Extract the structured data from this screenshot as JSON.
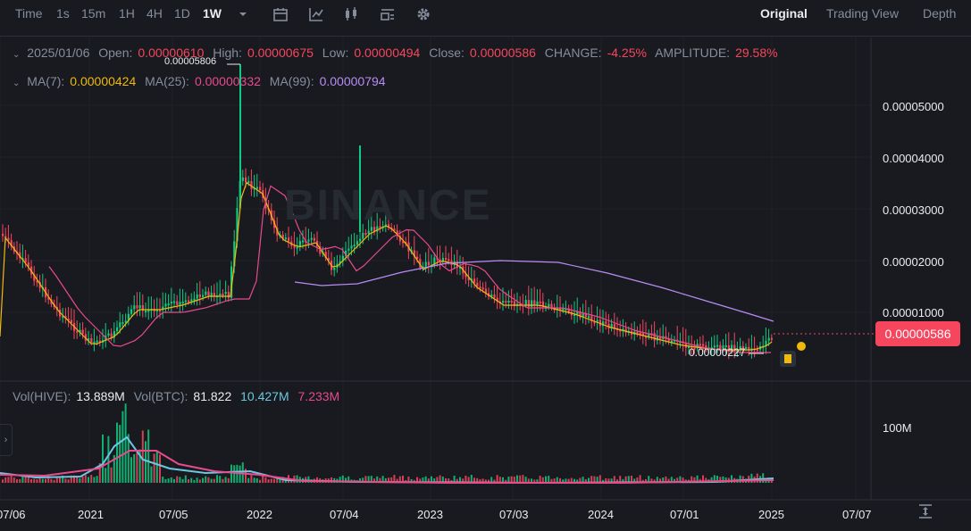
{
  "toolbar": {
    "time_label": "Time",
    "intervals": [
      "1s",
      "15m",
      "1H",
      "4H",
      "1D",
      "1W"
    ],
    "active_interval": "1W",
    "views": [
      "Original",
      "Trading View",
      "Depth"
    ],
    "active_view": "Original"
  },
  "ohlc": {
    "date": "2025/01/06",
    "open_label": "Open:",
    "open": "0.00000610",
    "high_label": "High:",
    "high": "0.00000675",
    "low_label": "Low:",
    "low": "0.00000494",
    "close_label": "Close:",
    "close": "0.00000586",
    "change_label": "CHANGE:",
    "change": "-4.25%",
    "amplitude_label": "AMPLITUDE:",
    "amplitude": "29.58%"
  },
  "ma": {
    "ma7_label": "MA(7):",
    "ma7": "0.00000424",
    "ma25_label": "MA(25):",
    "ma25": "0.00000332",
    "ma99_label": "MA(99):",
    "ma99": "0.00000794"
  },
  "volume": {
    "vol_hive_label": "Vol(HIVE):",
    "vol_hive": "13.889M",
    "vol_btc_label": "Vol(BTC):",
    "vol_btc": "81.822",
    "ma1": "10.427M",
    "ma2": "7.233M",
    "axis_label": "100M"
  },
  "annotations": {
    "max_price": "0.00005806",
    "min_price": "0.00000227"
  },
  "current_price": "0.00000586",
  "watermark": "BINANCE",
  "chart_data": {
    "type": "candlestick",
    "y_ticks": [
      "0.00005000",
      "0.00004000",
      "0.00003000",
      "0.00002000",
      "0.00001000"
    ],
    "x_ticks": [
      "07/06",
      "2021",
      "07/05",
      "2022",
      "07/04",
      "2023",
      "07/03",
      "2024",
      "07/01",
      "2025",
      "07/07"
    ],
    "colors": {
      "up": "#0ecb81",
      "down": "#f6465d",
      "ma7": "#f0b90b",
      "ma25": "#e84a8c",
      "ma99": "#b98cf5",
      "vol_ma1": "#6cc7e0",
      "vol_ma2": "#e84a8c"
    }
  }
}
